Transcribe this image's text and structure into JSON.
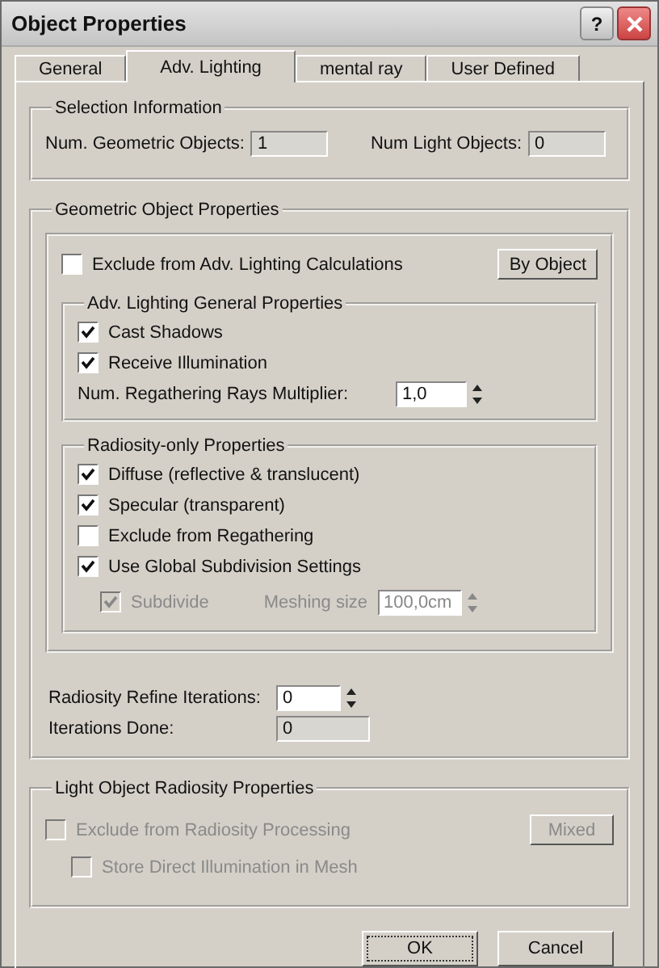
{
  "window": {
    "title": "Object Properties",
    "help_button": "?"
  },
  "tabs": [
    {
      "label": "General",
      "selected": false
    },
    {
      "label": "Adv. Lighting",
      "selected": true
    },
    {
      "label": "mental ray",
      "selected": false
    },
    {
      "label": "User Defined",
      "selected": false
    }
  ],
  "selection_information": {
    "title": "Selection Information",
    "fields": [
      {
        "label": "Num. Geometric Objects:",
        "value": "1"
      },
      {
        "label": "Num Light Objects:",
        "value": "0"
      }
    ]
  },
  "geometric_object_properties": {
    "title": "Geometric Object Properties",
    "exclude": {
      "label": "Exclude from Adv. Lighting Calculations",
      "checked": false
    },
    "by_object_button": "By Object",
    "general": {
      "title": "Adv. Lighting General Properties",
      "checks": [
        {
          "label": "Cast Shadows",
          "checked": true
        },
        {
          "label": "Receive Illumination",
          "checked": true
        }
      ],
      "spinner": {
        "label": "Num. Regathering Rays Multiplier:",
        "value": "1,0"
      }
    },
    "radiosity_only": {
      "title": "Radiosity-only Properties",
      "checks": [
        {
          "label": "Diffuse (reflective & translucent)",
          "checked": true
        },
        {
          "label": "Specular (transparent)",
          "checked": true
        },
        {
          "label": "Exclude from Regathering",
          "checked": false
        },
        {
          "label": "Use Global Subdivision Settings",
          "checked": true
        }
      ],
      "subdivide": {
        "label": "Subdivide",
        "checked": true,
        "disabled": true
      },
      "meshing_size": {
        "label": "Meshing size",
        "value": "100,0cm",
        "disabled": true
      }
    },
    "refine_iterations": {
      "label": "Radiosity Refine Iterations:",
      "value": "0"
    },
    "iterations_done": {
      "label": "Iterations Done:",
      "value": "0"
    }
  },
  "light_object_radiosity_properties": {
    "title": "Light Object Radiosity Properties",
    "exclude": {
      "label": "Exclude from Radiosity Processing",
      "checked": false,
      "disabled": true,
      "children": [
        {
          "label": "Store Direct Illumination in Mesh",
          "checked": false,
          "disabled": true
        }
      ]
    },
    "button": {
      "label": "Mixed",
      "disabled": true
    }
  },
  "buttons": [
    {
      "label": "OK",
      "focused": true
    },
    {
      "label": "Cancel",
      "focused": false
    }
  ]
}
